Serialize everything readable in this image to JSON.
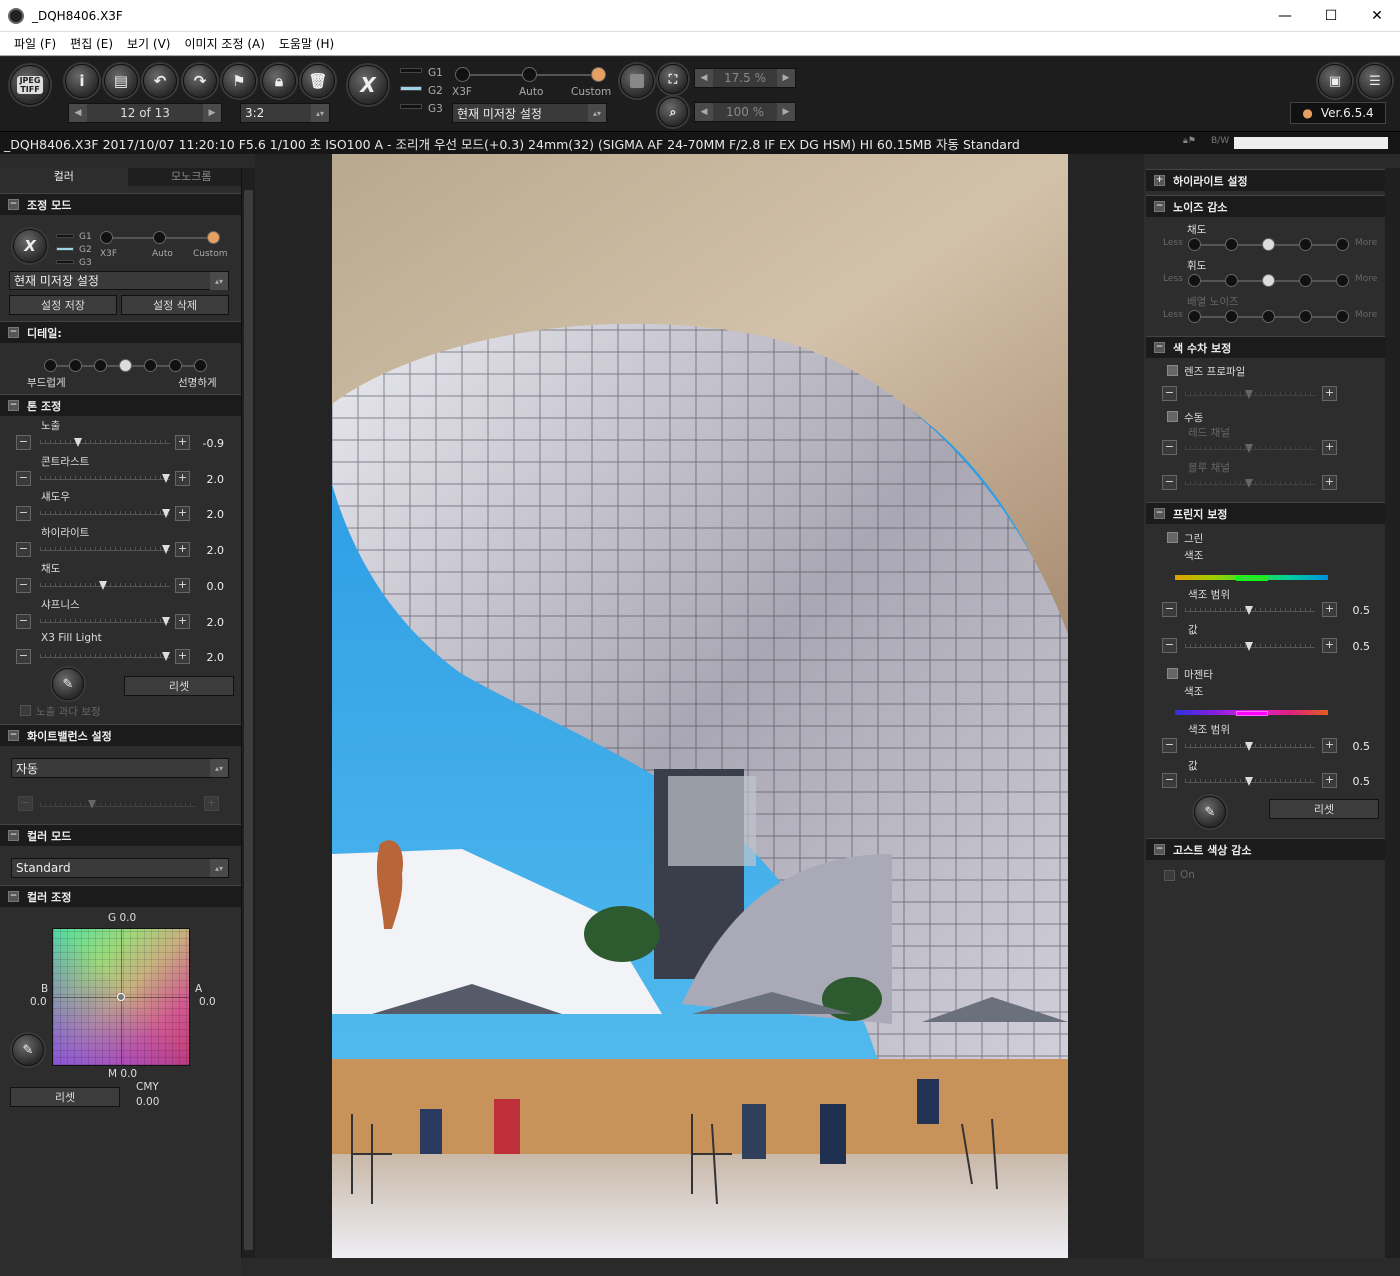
{
  "window": {
    "title": "_DQH8406.X3F",
    "minimize": "—",
    "maximize": "☐",
    "close": "✕"
  },
  "menu": [
    "파일 (F)",
    "편집 (E)",
    "보기 (V)",
    "이미지 조정 (A)",
    "도움말 (H)"
  ],
  "toolbar": {
    "jpeg_tiff": "JPEG TIFF",
    "image_counter": "12 of 13",
    "ratio": "3:2",
    "groups": [
      "G1",
      "G2",
      "G3"
    ],
    "mode_labels": [
      "X3F",
      "Auto",
      "Custom"
    ],
    "preset": "현재 미저장 설정",
    "zoom1": "17.5 %",
    "zoom2": "100 %",
    "version": "Ver.6.5.4"
  },
  "info": {
    "text": "_DQH8406.X3F 2017/10/07 11:20:10 F5.6 1/100 초 ISO100 A - 조리개 우선 모드(+0.3) 24mm(32) (SIGMA AF 24-70MM F/2.8 IF EX DG HSM) HI 60.15MB 자동 Standard",
    "bw": "B/W"
  },
  "left": {
    "tabs": [
      "컬러",
      "모노크롬"
    ],
    "adjust_mode": {
      "title": "조정 모드",
      "groups": [
        "G1",
        "G2",
        "G3"
      ],
      "mode_labels": [
        "X3F",
        "Auto",
        "Custom"
      ],
      "preset": "현재 미저장 설정",
      "save": "설정 저장",
      "delete": "설정 삭제"
    },
    "detail": {
      "title": "디테일:",
      "soft": "부드럽게",
      "sharp": "선명하게"
    },
    "tone": {
      "title": "톤 조정",
      "sliders": [
        {
          "label": "노출",
          "value": "-0.9",
          "pos": 0.3
        },
        {
          "label": "콘트라스트",
          "value": "2.0",
          "pos": 1.0
        },
        {
          "label": "섀도우",
          "value": "2.0",
          "pos": 1.0
        },
        {
          "label": "하이라이트",
          "value": "2.0",
          "pos": 1.0
        },
        {
          "label": "채도",
          "value": "0.0",
          "pos": 0.5
        },
        {
          "label": "샤프니스",
          "value": "2.0",
          "pos": 1.0
        },
        {
          "label": "X3 Fill Light",
          "value": "2.0",
          "pos": 1.0
        }
      ],
      "reset": "리셋",
      "overexposure": "노출 과다 보정"
    },
    "white_balance": {
      "title": "화이트밸런스 설정",
      "value": "자동"
    },
    "color_mode": {
      "title": "컬러 모드",
      "value": "Standard"
    },
    "color_adjust": {
      "title": "컬러 조정",
      "g": "G 0.0",
      "b": "B",
      "b_val": "0.0",
      "a": "A",
      "a_val": "0.0",
      "m": "M 0.0",
      "cmy": "CMY",
      "cmy_val": "0.00",
      "reset": "리셋"
    }
  },
  "right": {
    "highlight": {
      "title": "하이라이트 설정"
    },
    "noise": {
      "title": "노이즈 감소",
      "rows": [
        {
          "label": "채도",
          "less": "Less",
          "more": "More",
          "sel": 2,
          "active": true
        },
        {
          "label": "휘도",
          "less": "Less",
          "more": "More",
          "sel": 2,
          "active": true
        },
        {
          "label": "배열 노이즈",
          "less": "Less",
          "more": "More",
          "sel": -1,
          "active": false
        }
      ]
    },
    "chromatic": {
      "title": "색 수차 보정",
      "lens_profile": "렌즈 프로파일",
      "manual": "수동",
      "red": "레드 채널",
      "blue": "블루 채널"
    },
    "fringe": {
      "title": "프린지 보정",
      "green": "그린",
      "magenta": "마젠타",
      "hue": "색조",
      "range": "색조 범위",
      "value_label": "값",
      "green_range": "0.5",
      "green_value": "0.5",
      "mag_range": "0.5",
      "mag_value": "0.5",
      "reset": "리셋"
    },
    "ghost": {
      "title": "고스트 색상 감소",
      "on": "On"
    }
  },
  "colors": {
    "accent": "#e8a060",
    "panel": "#2d2d2d",
    "header": "#1b1b1b"
  }
}
